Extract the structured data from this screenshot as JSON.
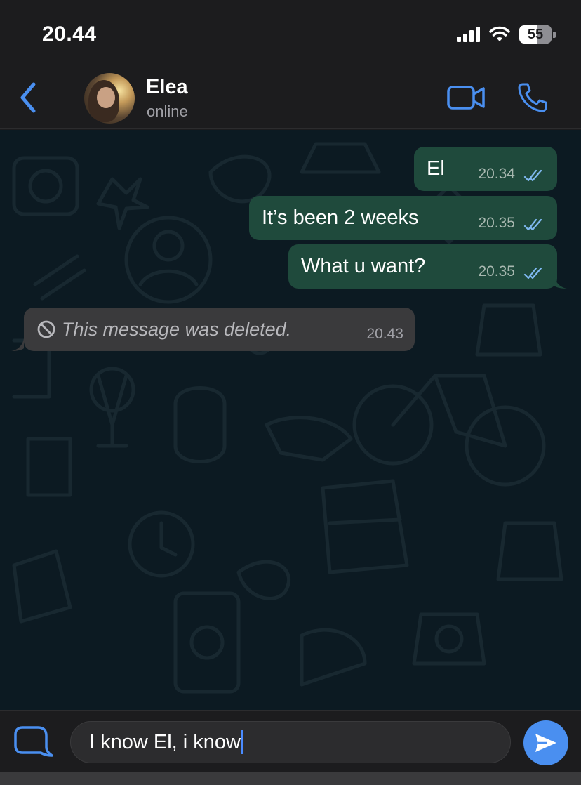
{
  "status_bar": {
    "time": "20.44",
    "battery": "55"
  },
  "header": {
    "contact_name": "Elea",
    "contact_status": "online"
  },
  "messages": [
    {
      "direction": "outgoing",
      "text": "El",
      "time": "20.34",
      "read": true
    },
    {
      "direction": "outgoing",
      "text": "It’s been 2 weeks",
      "time": "20.35",
      "read": true
    },
    {
      "direction": "outgoing",
      "text": "What u want?",
      "time": "20.35",
      "read": true
    },
    {
      "direction": "incoming",
      "text": "This message was deleted.",
      "time": "20.43",
      "deleted": true
    }
  ],
  "composer": {
    "text": "I know El, i know"
  },
  "colors": {
    "accent": "#4a8ff0",
    "outgoing_bubble": "#1f4a3c",
    "incoming_bubble": "#3a3a3c",
    "chat_background": "#0c1a22",
    "read_ticks": "#7fb8f0"
  },
  "icons": [
    "back-chevron-icon",
    "video-call-icon",
    "phone-icon",
    "deleted-message-icon",
    "read-ticks-icon",
    "sticker-icon",
    "send-icon"
  ]
}
